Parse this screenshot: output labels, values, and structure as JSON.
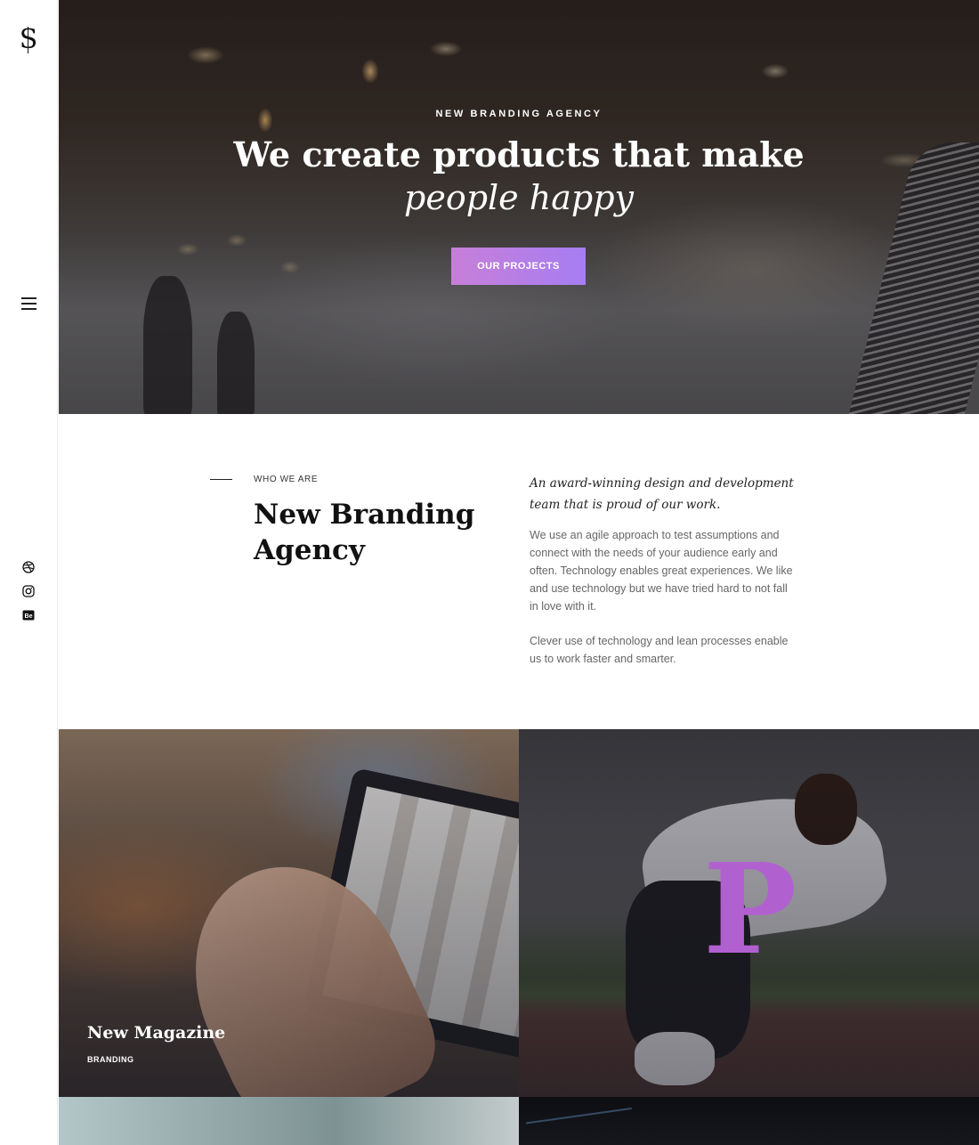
{
  "sidebar": {
    "logo": "S",
    "menu_icon": "hamburger-menu-icon",
    "socials": [
      {
        "name": "dribbble-icon"
      },
      {
        "name": "instagram-icon"
      },
      {
        "name": "behance-icon",
        "text": "Be"
      }
    ]
  },
  "hero": {
    "tagline": "NEW BRANDING AGENCY",
    "title": "We create products that make",
    "subtitle": "people happy",
    "cta": "OUR PROJECTS"
  },
  "about": {
    "eyebrow": "WHO WE ARE",
    "title": "New Branding Agency",
    "lead": "An award-winning design and development team that is proud of our work.",
    "paragraph1": "We use an agile approach to test assumptions and connect with the needs of your audience early and often. Technology enables great experiences. We like and use technology but we have tried hard to not fall in love with it.",
    "paragraph2": "Clever use of technology and lean processes enable us to work faster and smarter."
  },
  "projects": [
    {
      "title": "New Magazine",
      "category": "BRANDING"
    },
    {
      "letter": "P"
    },
    {},
    {}
  ],
  "colors": {
    "accent_start": "#c77fd8",
    "accent_end": "#a67ef2",
    "accent_letter": "#b160d0"
  }
}
